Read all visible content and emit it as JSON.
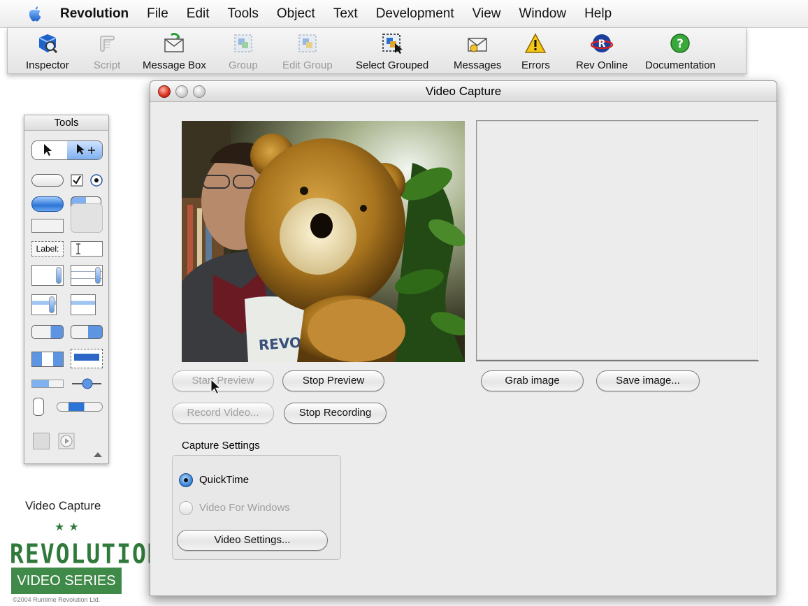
{
  "menubar": {
    "app_name": "Revolution",
    "items": [
      "File",
      "Edit",
      "Tools",
      "Object",
      "Text",
      "Development",
      "View",
      "Window",
      "Help"
    ]
  },
  "toolbar": {
    "buttons": [
      {
        "label": "Inspector",
        "icon": "inspector-icon",
        "enabled": true
      },
      {
        "label": "Script",
        "icon": "script-icon",
        "enabled": false
      },
      {
        "label": "Message Box",
        "icon": "message-box-icon",
        "enabled": true
      },
      {
        "label": "Group",
        "icon": "group-icon",
        "enabled": false
      },
      {
        "label": "Edit Group",
        "icon": "edit-group-icon",
        "enabled": false
      },
      {
        "label": "Select Grouped",
        "icon": "select-grouped-icon",
        "enabled": true
      },
      {
        "label": "Messages",
        "icon": "messages-icon",
        "enabled": true
      },
      {
        "label": "Errors",
        "icon": "errors-warning-icon",
        "enabled": true
      },
      {
        "label": "Rev Online",
        "icon": "rev-online-icon",
        "enabled": true
      },
      {
        "label": "Documentation",
        "icon": "documentation-help-icon",
        "enabled": true
      }
    ]
  },
  "tools_palette": {
    "title": "Tools",
    "label_tool_text": "Label:"
  },
  "window": {
    "title": "Video Capture",
    "buttons": {
      "start_preview": "Start Preview",
      "stop_preview": "Stop Preview",
      "record_video": "Record Video...",
      "stop_recording": "Stop Recording",
      "grab_image": "Grab image",
      "save_image": "Save image...",
      "video_settings": "Video Settings..."
    },
    "capture_settings": {
      "label": "Capture Settings",
      "options": [
        {
          "label": "QuickTime",
          "selected": true,
          "enabled": true
        },
        {
          "label": "Video For Windows",
          "selected": false,
          "enabled": false
        }
      ]
    },
    "preview_shirt_text": "REVOLUTION"
  },
  "branding": {
    "title": "Video Capture",
    "stars": "★★",
    "logo_text": "REVOLUTION",
    "series_text": "VIDEO SERIES",
    "copyright": "©2004 Runtime Revolution Ltd."
  },
  "colors": {
    "brand_green": "#3f8a49",
    "accent_blue": "#3d87d8",
    "close_red": "#d92e1c"
  }
}
